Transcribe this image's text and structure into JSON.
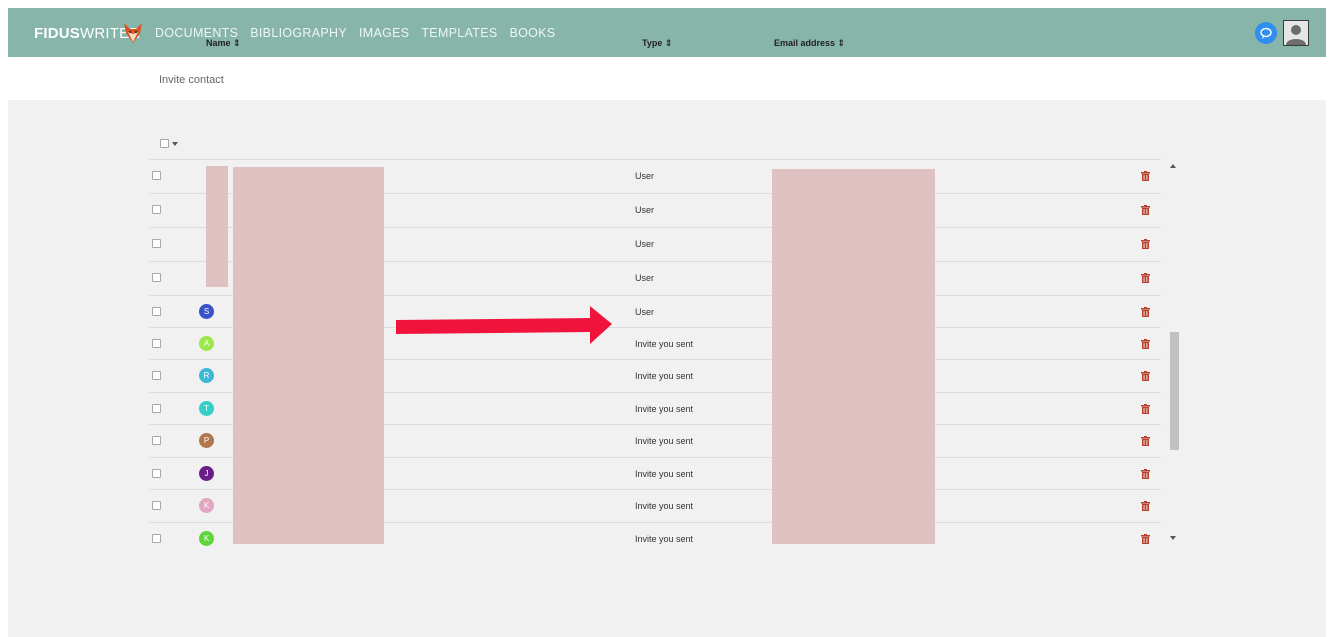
{
  "app": {
    "logo_bold": "FIDUS",
    "logo_light": "WRITER"
  },
  "nav": {
    "documents": "DOCUMENTS",
    "bibliography": "BIBLIOGRAPHY",
    "images": "IMAGES",
    "templates": "TEMPLATES",
    "books": "BOOKS"
  },
  "subheader": {
    "invite_contact": "Invite contact"
  },
  "table": {
    "headers": {
      "name": "Name ⇕",
      "type": "Type ⇕",
      "email": "Email address ⇕"
    },
    "rows": [
      {
        "type": "User"
      },
      {
        "type": "User"
      },
      {
        "type": "User"
      },
      {
        "type": "User"
      },
      {
        "initial": "S",
        "type": "User",
        "color": "#3a53c9"
      },
      {
        "initial": "A",
        "type": "Invite you sent",
        "color": "#9be84a"
      },
      {
        "initial": "R",
        "type": "Invite you sent",
        "color": "#3db8d5"
      },
      {
        "initial": "T",
        "type": "Invite you sent",
        "color": "#33cfc8"
      },
      {
        "initial": "P",
        "type": "Invite you sent",
        "color": "#b0774d"
      },
      {
        "initial": "J",
        "type": "Invite you sent",
        "color": "#6a1f88"
      },
      {
        "initial": "K",
        "type": "Invite you sent",
        "color": "#e3a5bf"
      },
      {
        "initial": "K",
        "type": "Invite you sent",
        "color": "#5ed63a"
      }
    ]
  },
  "colors": {
    "navbar": "#87b5a9",
    "trash": "#b8402d",
    "arrow": "#f0143c",
    "redaction": "#dfc1c1"
  },
  "icons": {
    "chat": "chat-bubble-icon",
    "user": "user-avatar-icon",
    "trash": "trash-icon",
    "arrow": "red-arrow-annotation"
  }
}
